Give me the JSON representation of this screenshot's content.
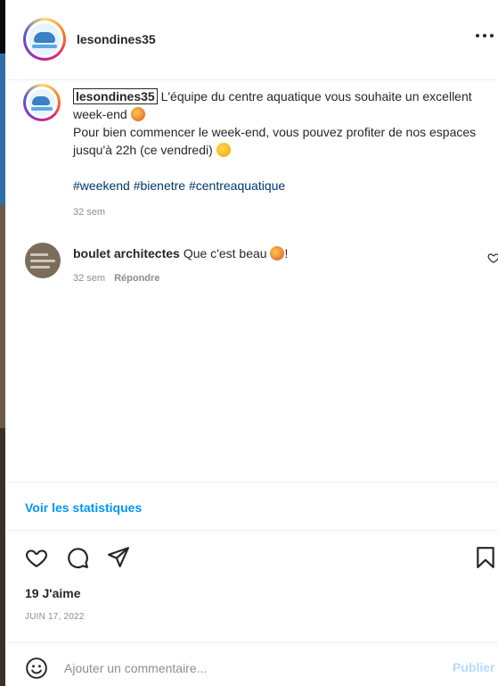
{
  "post_header": {
    "username": "lesondines35"
  },
  "caption": {
    "username": "lesondines35",
    "line1": " L'équipe du centre aquatique vous souhaite un excellent week-end ",
    "line2": "Pour bien commencer le week-end, vous pouvez profiter de nos espaces jusqu'à 22h (ce vendredi) ",
    "hashtags": "#weekend #bienetre #centreaquatique",
    "time": "32 sem"
  },
  "comment": {
    "username": "boulet architectes",
    "text": "Que c'est beau ",
    "text_end": "!",
    "time": "32 sem",
    "reply_label": "Répondre"
  },
  "stats_link": "Voir les statistiques",
  "likes": "19 J'aime",
  "date": "JUIN 17, 2022",
  "comment_box": {
    "placeholder": "Ajouter un commentaire...",
    "publish_label": "Publier"
  },
  "icons": {
    "more": "more-horizontal-icon",
    "like": "heart-icon",
    "comment": "comment-bubble-icon",
    "share": "paper-plane-icon",
    "save": "bookmark-icon",
    "emoji": "smiley-icon",
    "comment_like": "heart-outline-icon"
  },
  "colors": {
    "link": "#0095f6",
    "hashtag": "#00376b",
    "publish_disabled": "#b3dbff"
  }
}
